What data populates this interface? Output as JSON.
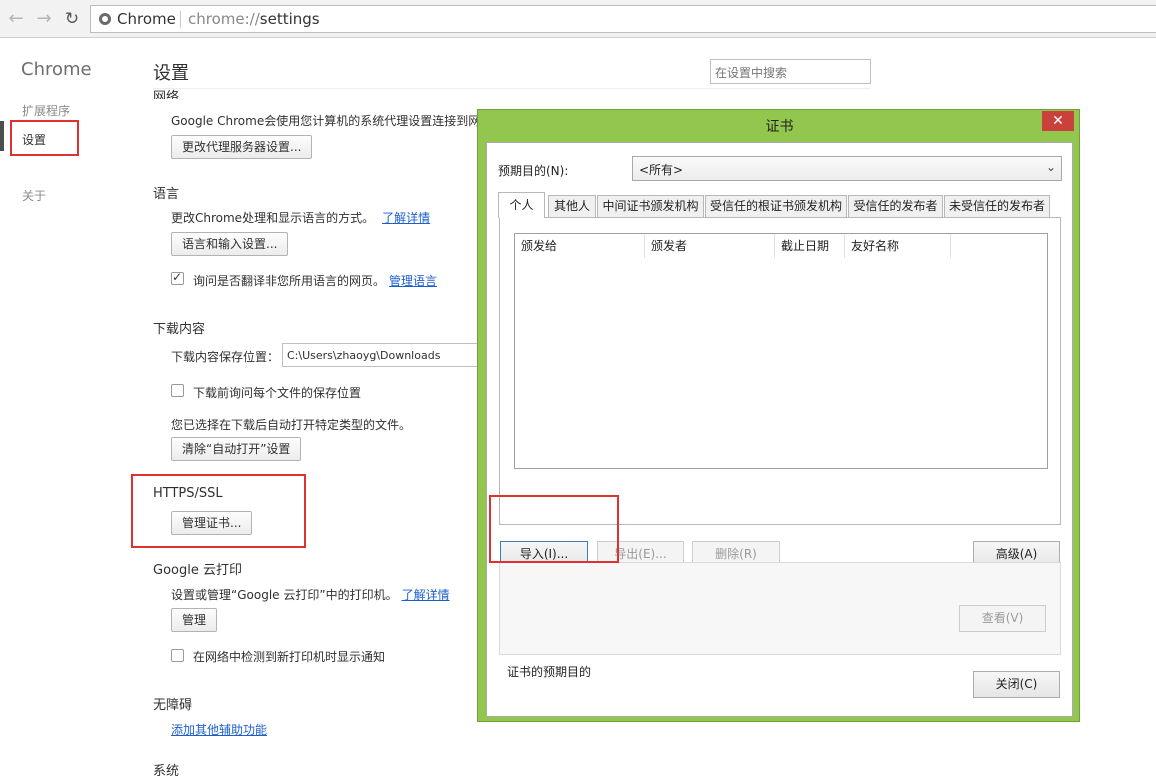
{
  "browser": {
    "back_icon": "arrow-left-icon",
    "forward_icon": "arrow-right-icon",
    "reload_icon": "reload-icon",
    "site_label": "Chrome",
    "url_scheme": "chrome://",
    "url_path": "settings"
  },
  "sidebar": {
    "brand": "Chrome",
    "items": [
      {
        "label": "扩展程序"
      },
      {
        "label": "设置"
      },
      {
        "label": "关于"
      }
    ]
  },
  "settings": {
    "title": "设置",
    "search_placeholder": "在设置中搜索",
    "network": {
      "title": "网络",
      "desc": "Google Chrome会使用您计算机的系统代理设置连接到网络",
      "button": "更改代理服务器设置..."
    },
    "language": {
      "title": "语言",
      "desc": "更改Chrome处理和显示语言的方式。",
      "link": "了解详情",
      "button": "语言和输入设置...",
      "translate_label": "询问是否翻译非您所用语言的网页。",
      "translate_link": "管理语言",
      "translate_checked": true
    },
    "downloads": {
      "title": "下载内容",
      "location_label": "下载内容保存位置：",
      "location_value": "C:\\Users\\zhaoyg\\Downloads",
      "ask_label": "下载前询问每个文件的保存位置",
      "ask_checked": false,
      "auto_open_desc": "您已选择在下载后自动打开特定类型的文件。",
      "clear_button": "清除“自动打开”设置"
    },
    "https": {
      "title": "HTTPS/SSL",
      "button": "管理证书..."
    },
    "cloud_print": {
      "title": "Google 云打印",
      "desc": "设置或管理“Google 云打印”中的打印机。",
      "link": "了解详情",
      "button": "管理",
      "notify_label": "在网络中检测到新打印机时显示通知",
      "notify_checked": false
    },
    "accessibility": {
      "title": "无障碍",
      "link": "添加其他辅助功能"
    },
    "system": {
      "title": "系统"
    }
  },
  "dialog": {
    "title": "证书",
    "close_icon": "close-icon",
    "purpose_label": "预期目的(N):",
    "purpose_value": "<所有>",
    "tabs": [
      {
        "label": "个人"
      },
      {
        "label": "其他人"
      },
      {
        "label": "中间证书颁发机构"
      },
      {
        "label": "受信任的根证书颁发机构"
      },
      {
        "label": "受信任的发布者"
      },
      {
        "label": "未受信任的发布者"
      }
    ],
    "columns": [
      "颁发给",
      "颁发者",
      "截止日期",
      "友好名称"
    ],
    "buttons": {
      "import": "导入(I)...",
      "export": "导出(E)...",
      "remove": "删除(R)",
      "advanced": "高级(A)",
      "view": "查看(V)",
      "close": "关闭(C)"
    },
    "cert_purpose_label": "证书的预期目的"
  },
  "colors": {
    "dialog_frame": "#92c64e",
    "highlight": "#e03131",
    "link": "#1c5fcc"
  }
}
